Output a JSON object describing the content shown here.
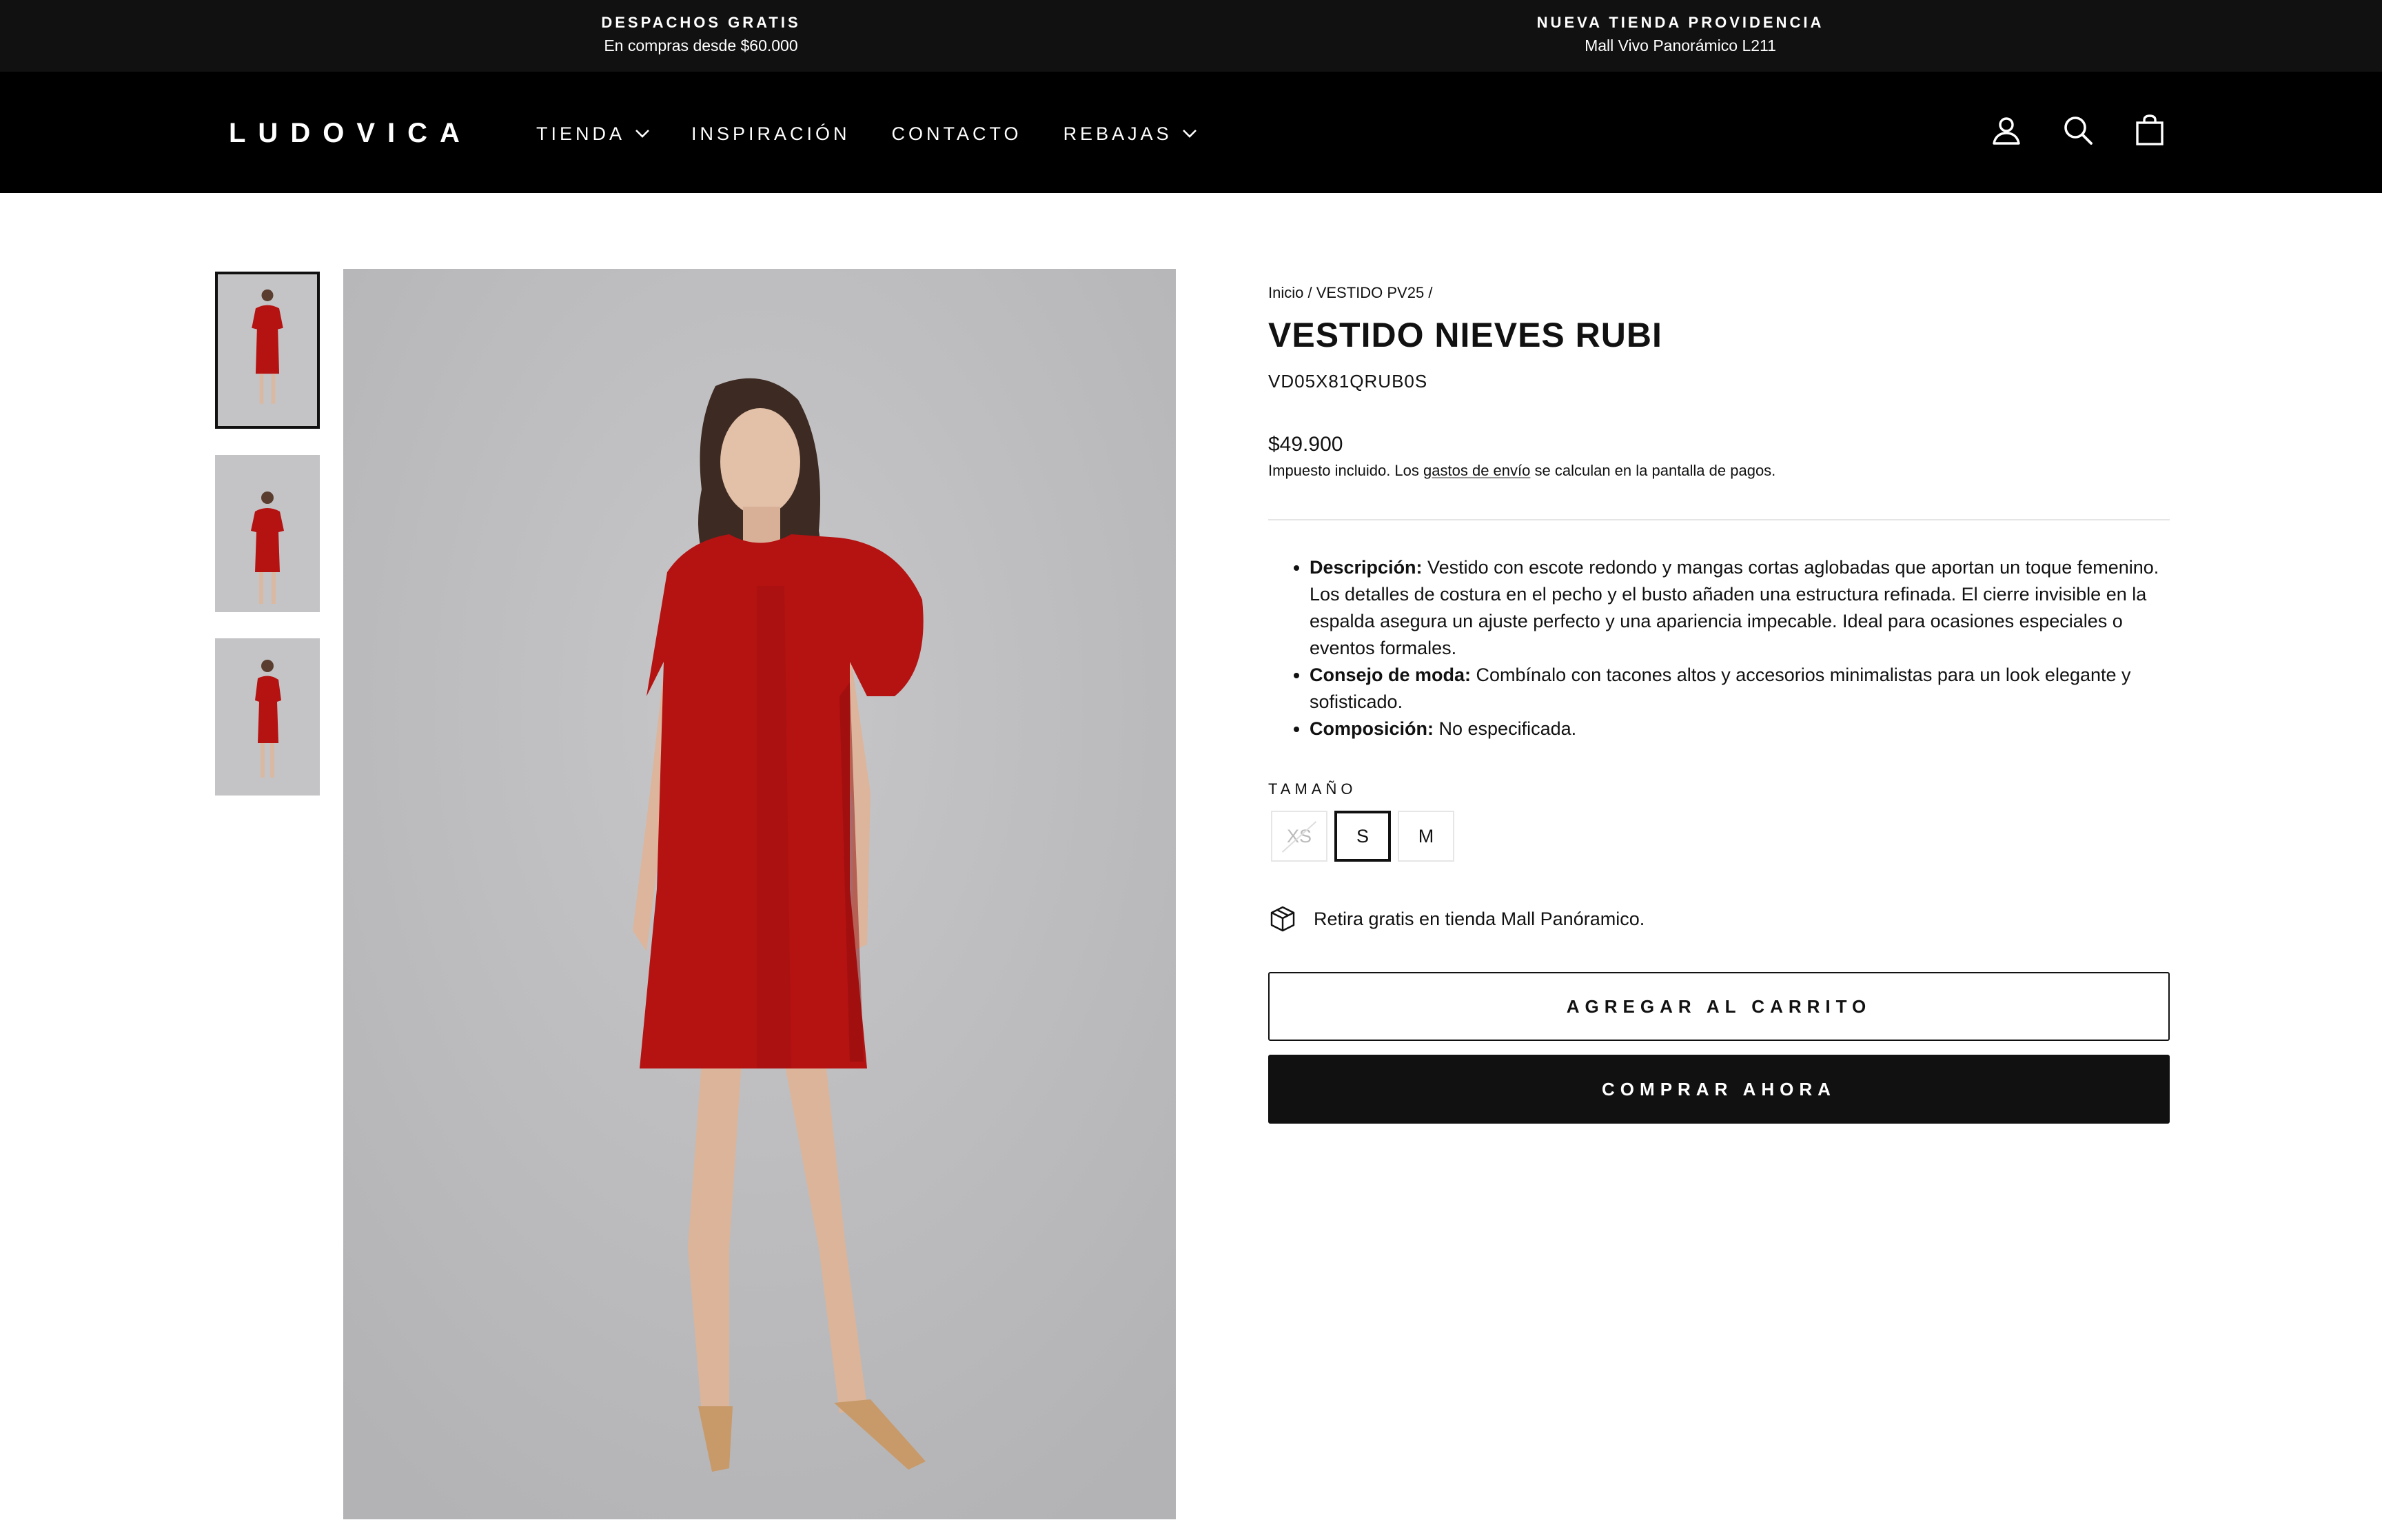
{
  "announcement": {
    "left": {
      "title": "DESPACHOS GRATIS",
      "subtitle": "En compras desde $60.000"
    },
    "right": {
      "title": "NUEVA TIENDA PROVIDENCIA",
      "subtitle": "Mall Vivo Panorámico L211"
    }
  },
  "header": {
    "logo": "LUDOVICA",
    "nav": [
      {
        "label": "TIENDA",
        "has_dropdown": true
      },
      {
        "label": "INSPIRACIÓN",
        "has_dropdown": false
      },
      {
        "label": "CONTACTO",
        "has_dropdown": false
      },
      {
        "label": "REBAJAS",
        "has_dropdown": true
      }
    ],
    "icons": [
      "user-icon",
      "search-icon",
      "bag-icon"
    ]
  },
  "gallery": {
    "thumbnails": 3,
    "active_index": 0
  },
  "product": {
    "breadcrumb": {
      "home": "Inicio",
      "sep": " / ",
      "collection": "VESTIDO PV25",
      "trail": " /"
    },
    "title": "VESTIDO NIEVES RUBI",
    "sku": "VD05X81QRUB0S",
    "price": "$49.900",
    "tax_note": {
      "before": "Impuesto incluido. Los ",
      "link": "gastos de envío",
      "after": " se calculan en la pantalla de pagos."
    },
    "description": [
      {
        "label": "Descripción:",
        "text": " Vestido con escote redondo y mangas cortas aglobadas que aportan un toque femenino. Los detalles de costura en el pecho y el busto añaden una estructura refinada. El cierre invisible en la espalda asegura un ajuste perfecto y una apariencia impecable. Ideal para ocasiones especiales o eventos formales."
      },
      {
        "label": "Consejo de moda:",
        "text": " Combínalo con tacones altos y accesorios minimalistas para un look elegante y sofisticado."
      },
      {
        "label": "Composición:",
        "text": " No especificada."
      }
    ],
    "size_label": "TAMAÑO",
    "sizes": [
      {
        "label": "XS",
        "available": false,
        "selected": false
      },
      {
        "label": "S",
        "available": true,
        "selected": true
      },
      {
        "label": "M",
        "available": true,
        "selected": false
      }
    ],
    "pickup": "Retira gratis en tienda Mall Panóramico.",
    "add_to_cart": "AGREGAR AL CARRITO",
    "buy_now": "COMPRAR AHORA"
  },
  "colors": {
    "announcement_bg": "#111111",
    "header_bg": "#000000",
    "dress_red": "#b51212",
    "photo_bg": "#bdbdbf",
    "button_dark": "#111111"
  }
}
